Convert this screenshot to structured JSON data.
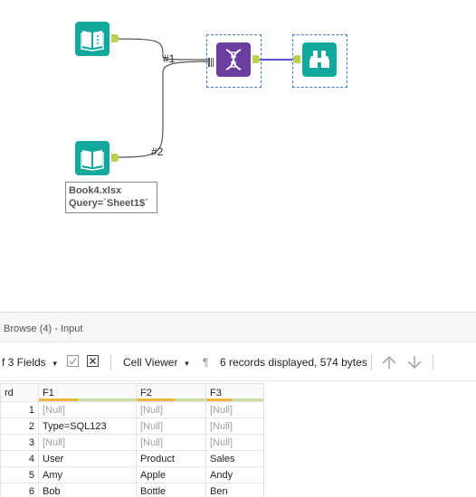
{
  "canvas": {
    "connections": [
      {
        "label": "#1"
      },
      {
        "label": "#2"
      }
    ],
    "annotation": {
      "line1": "Book4.xlsx",
      "line2": "Query=`Sheet1$`"
    },
    "colors": {
      "input_tool": "#13a89e",
      "formula_tool": "#6a3fa0",
      "browse_tool": "#13a89e",
      "anchor": "#b7d34d",
      "selection": "#3a7bd5",
      "wire_selected": "#3b3bd1"
    },
    "icons": [
      "book-icon",
      "book-icon",
      "dna-icon",
      "binoculars-icon"
    ]
  },
  "panel": {
    "title": "Browse (4) - Input"
  },
  "toolbar": {
    "fields_label": "f 3 Fields",
    "viewer_label": "Cell Viewer",
    "pilcrow": "¶",
    "status": "6 records displayed, 574 bytes"
  },
  "grid": {
    "headers": [
      "rd",
      "F1",
      "F2",
      "F3"
    ],
    "rows": [
      [
        "1",
        "[Null]",
        "[Null]",
        "[Null]"
      ],
      [
        "2",
        "Type=SQL123",
        "[Null]",
        "[Null]"
      ],
      [
        "3",
        "[Null]",
        "[Null]",
        "[Null]"
      ],
      [
        "4",
        "User",
        "Product",
        "Sales"
      ],
      [
        "5",
        "Amy",
        "Apple",
        "Andy"
      ],
      [
        "6",
        "Bob",
        "Bottle",
        "Ben"
      ]
    ]
  }
}
